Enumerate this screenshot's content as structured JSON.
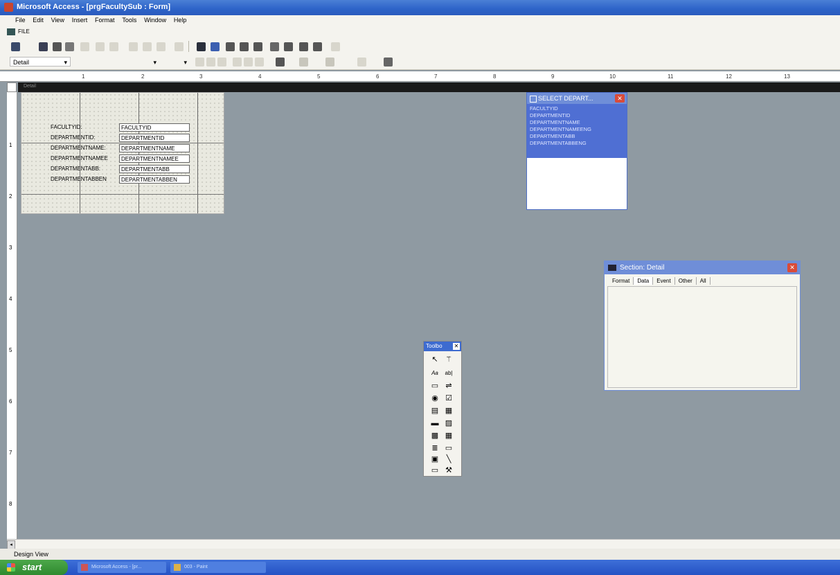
{
  "window": {
    "title": "Microsoft Access - [prgFacultySub : Form]"
  },
  "menu": {
    "items": [
      "File",
      "Edit",
      "View",
      "Insert",
      "Format",
      "Tools",
      "Window",
      "Help"
    ]
  },
  "filebar": {
    "label": "FILE"
  },
  "toolbar": {
    "object_selector": "Detail"
  },
  "ruler": {
    "ticks": [
      "1",
      "2",
      "3",
      "4",
      "5",
      "6",
      "7",
      "8",
      "9",
      "10",
      "11",
      "12",
      "13"
    ]
  },
  "vruler": {
    "ticks": [
      "1",
      "2",
      "3",
      "4",
      "5",
      "6",
      "7",
      "8"
    ]
  },
  "section": {
    "detail_label": "Detail"
  },
  "form": {
    "labels": [
      "FACULTYID:",
      "DEPARTMENTID:",
      "DEPARTMENTNAME:",
      "DEPARTMENTNAMEE",
      "DEPARTMENTABB:",
      "DEPARTMENTABBEN"
    ],
    "textboxes": [
      "FACULTYID",
      "DEPARTMENTID",
      "DEPARTMENTNAME",
      "DEPARTMENTNAMEE",
      "DEPARTMENTABB",
      "DEPARTMENTABBEN"
    ]
  },
  "fieldlist": {
    "title": "SELECT DEPART...",
    "fields": [
      "FACULTYID",
      "DEPARTMENTID",
      "DEPARTMENTNAME",
      "DEPARTMENTNAMEENG",
      "DEPARTMENTABB",
      "DEPARTMENTABBENG"
    ]
  },
  "properties": {
    "title": "Section: Detail",
    "tabs": [
      "Format",
      "Data",
      "Event",
      "Other",
      "All"
    ]
  },
  "toolbox": {
    "title": "Toolbo",
    "tools": [
      "select-icon",
      "wizard-icon",
      "label-icon",
      "textbox-icon",
      "option-group-icon",
      "toggle-icon",
      "option-button-icon",
      "checkbox-icon",
      "combobox-icon",
      "listbox-icon",
      "command-button-icon",
      "image-icon",
      "unbound-frame-icon",
      "bound-frame-icon",
      "page-break-icon",
      "tab-control-icon",
      "subform-icon",
      "line-icon",
      "rectangle-icon",
      "more-controls-icon"
    ]
  },
  "status": {
    "text": "Design View"
  },
  "taskbar": {
    "start": "start",
    "tasks": [
      "Microsoft Access - [pr...",
      "003 - Paint"
    ]
  }
}
